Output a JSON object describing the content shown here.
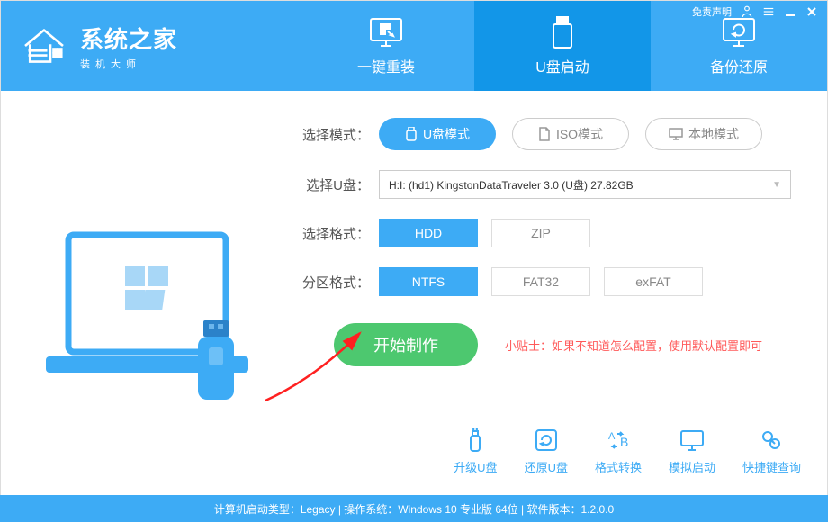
{
  "header": {
    "disclaimer": "免责声明",
    "logo_main": "系统之家",
    "logo_sub": "装机大师"
  },
  "tabs": {
    "reinstall": "一键重装",
    "usb_boot": "U盘启动",
    "backup": "备份还原"
  },
  "labels": {
    "select_mode": "选择模式：",
    "select_usb": "选择U盘：",
    "select_format": "选择格式：",
    "partition_format": "分区格式："
  },
  "mode_buttons": {
    "usb": "U盘模式",
    "iso": "ISO模式",
    "local": "本地模式"
  },
  "usb_selected": "H:I: (hd1) KingstonDataTraveler 3.0 (U盘) 27.82GB",
  "format_options": {
    "hdd": "HDD",
    "zip": "ZIP"
  },
  "partition_options": {
    "ntfs": "NTFS",
    "fat32": "FAT32",
    "exfat": "exFAT"
  },
  "start_button": "开始制作",
  "tip": "小贴士：如果不知道怎么配置，使用默认配置即可",
  "actions": {
    "upgrade": "升级U盘",
    "restore": "还原U盘",
    "convert": "格式转换",
    "simulate": "模拟启动",
    "hotkey": "快捷键查询"
  },
  "status": "计算机启动类型：Legacy | 操作系统：Windows 10 专业版 64位 | 软件版本：1.2.0.0"
}
